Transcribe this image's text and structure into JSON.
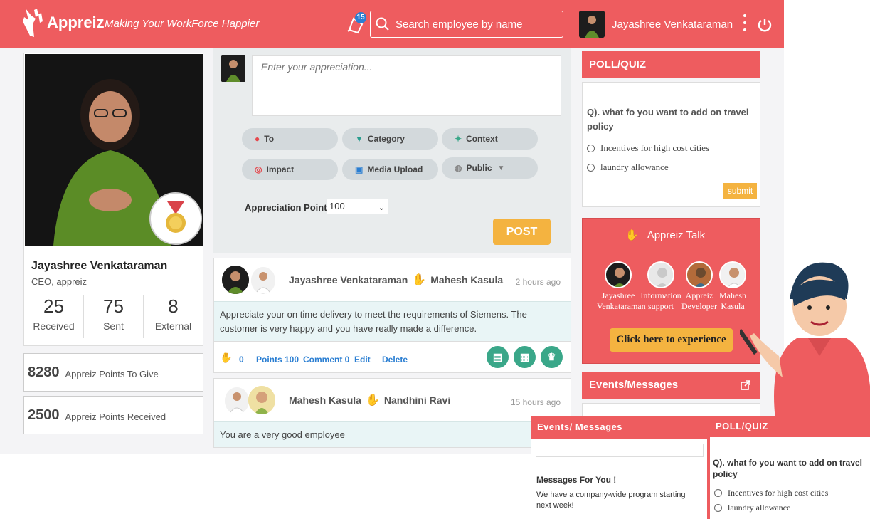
{
  "header": {
    "brand": "Appreiz",
    "tagline": "Making Your WorkForce Happier",
    "notification_count": "15",
    "search_placeholder": "Search employee by name",
    "user_name": "Jayashree Venkataraman"
  },
  "profile": {
    "name": "Jayashree Venkataraman",
    "role": "CEO, appreiz",
    "stats": [
      {
        "value": "25",
        "label": "Received"
      },
      {
        "value": "75",
        "label": "Sent"
      },
      {
        "value": "8",
        "label": "External"
      }
    ],
    "points_to_give": {
      "value": "8280",
      "label": "Appreiz Points To Give"
    },
    "points_received": {
      "value": "2500",
      "label": "Appreiz Points Received"
    }
  },
  "composer": {
    "placeholder": "Enter your appreciation...",
    "buttons": {
      "to": "To",
      "category": "Category",
      "context": "Context",
      "impact": "Impact",
      "media": "Media Upload",
      "public": "Public"
    },
    "points_label": "Appreciation Points",
    "points_value": "100",
    "post": "POST"
  },
  "posts": [
    {
      "from": "Jayashree Venkataraman",
      "to": "Mahesh Kasula",
      "time": "2 hours ago",
      "message": "Appreciate your on time delivery to meet the requirements of Siemens. The customer is very happy and you have really made a difference.",
      "likes": "0",
      "points": "Points 100",
      "comments": "Comment 0",
      "edit": "Edit",
      "delete": "Delete"
    },
    {
      "from": "Mahesh Kasula",
      "to": "Nandhini Ravi",
      "time": "15 hours ago",
      "message": "You are a very good employee"
    }
  ],
  "poll": {
    "title": "POLL/QUIZ",
    "question": "Q). what fo you want to add on travel policy",
    "options": [
      "Incentives for high cost cities",
      "laundry allowance"
    ],
    "submit": "submit"
  },
  "talk": {
    "title": "Appreiz Talk",
    "people": [
      {
        "line1": "Jayashree",
        "line2": "Venkataraman"
      },
      {
        "line1": "Information",
        "line2": "support"
      },
      {
        "line1": "Appreiz",
        "line2": "Developer"
      },
      {
        "line1": "Mahesh",
        "line2": "Kasula"
      }
    ],
    "cta": "Click here to experience"
  },
  "events": {
    "title": "Events/Messages"
  },
  "overlay_events": {
    "title": "Events/ Messages",
    "heading": "Messages For You !",
    "body": "We have a company-wide program starting next week!"
  },
  "overlay_poll": {
    "title": "POLL/QUIZ",
    "question": "Q). what fo you want to add on travel policy",
    "options": [
      "Incentives for high cost cities",
      "laundry allowance"
    ]
  },
  "colors": {
    "brand_red": "#ee5c5f",
    "accent_yellow": "#f4b340",
    "link_blue": "#2a7ed2"
  }
}
